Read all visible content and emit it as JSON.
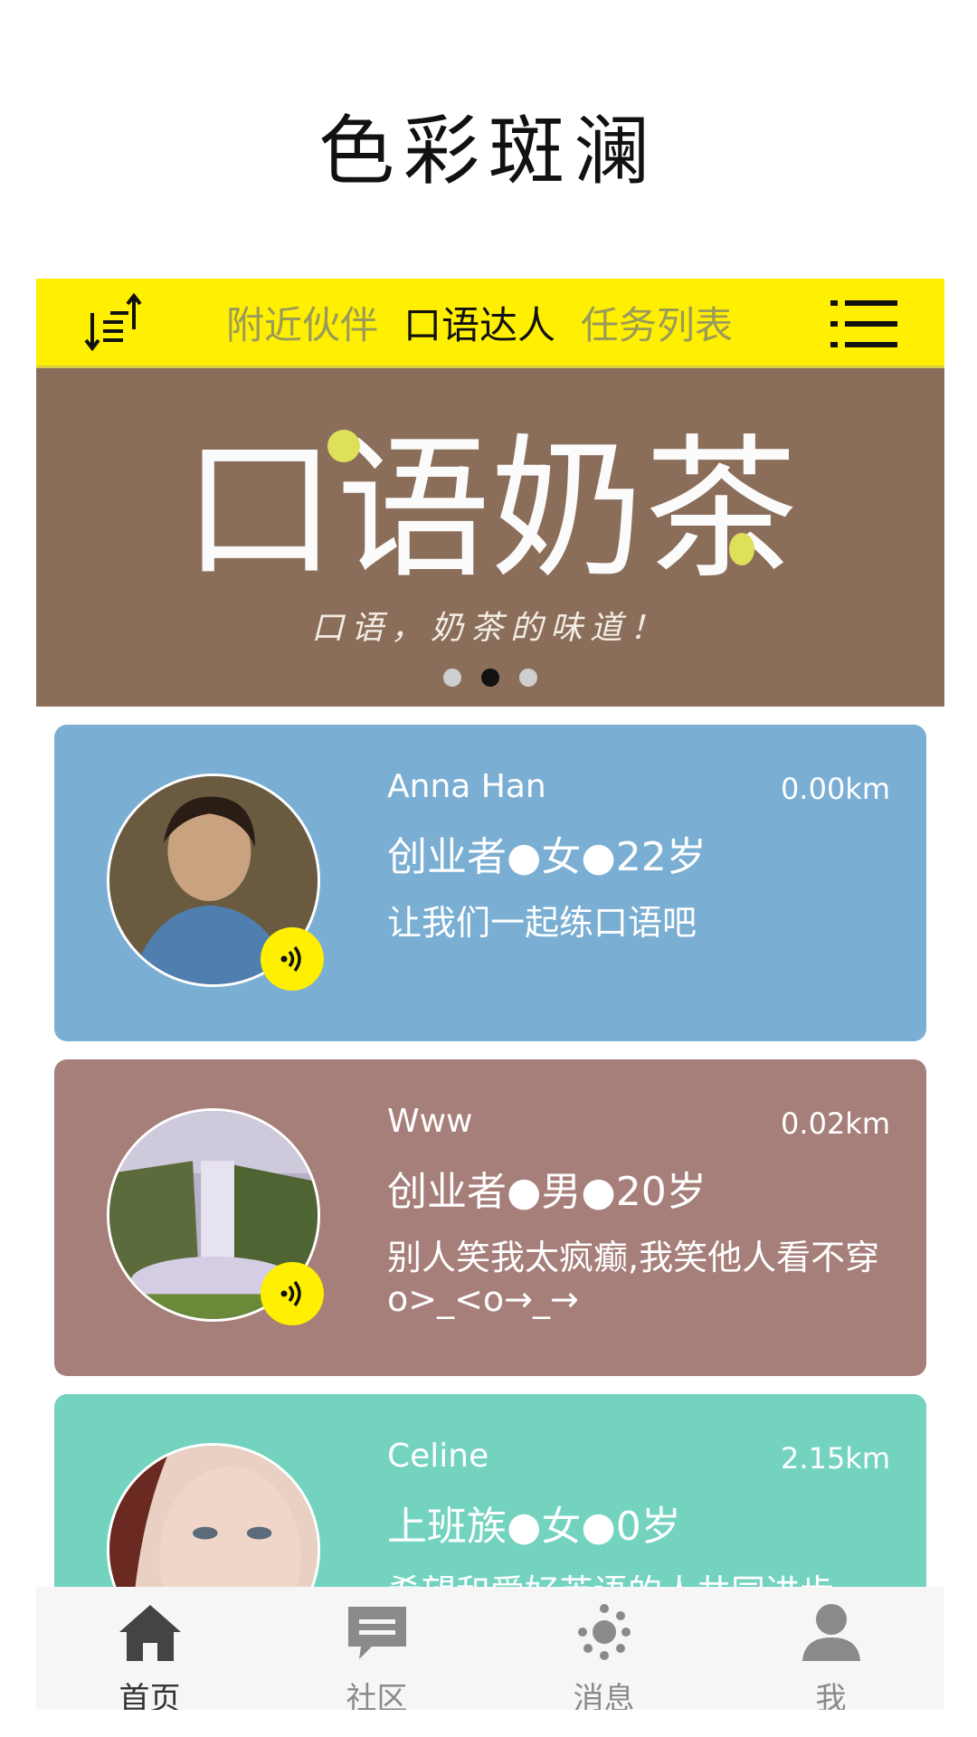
{
  "page": {
    "title": "色彩斑澜"
  },
  "topbar": {
    "tabs": [
      {
        "label": "附近伙伴",
        "active": false
      },
      {
        "label": "口语达人",
        "active": true
      },
      {
        "label": "任务列表",
        "active": false
      }
    ],
    "left_icon": "sort-icon",
    "right_icon": "menu-icon"
  },
  "banner": {
    "logo_text": "口语奶茶",
    "slogan": "口语，奶茶的味道！",
    "background": "#8b6e5a",
    "accent": "#dfe05a",
    "active_dot": 2,
    "dot_count": 3
  },
  "cards": [
    {
      "name": "Anna Han",
      "distance": "0.00km",
      "info": "创业者●女●22岁",
      "motto": "让我们一起练口语吧",
      "color": "#7aaed3"
    },
    {
      "name": "Www",
      "distance": "0.02km",
      "info": "创业者●男●20岁",
      "motto": "别人笑我太疯癫,我笑他人看不穿o>_<o→_→",
      "color": "#a77f7a"
    },
    {
      "name": "Celine",
      "distance": "2.15km",
      "info": "上班族●女●0岁",
      "motto": "希望和爱好英语的人共同进步",
      "color": "#73d3bf"
    }
  ],
  "bottom_nav": [
    {
      "label": "首页",
      "icon": "home-icon",
      "active": true
    },
    {
      "label": "社区",
      "icon": "chat-icon",
      "active": false
    },
    {
      "label": "消息",
      "icon": "message-dots-icon",
      "active": false
    },
    {
      "label": "我",
      "icon": "user-icon",
      "active": false
    }
  ],
  "colors": {
    "accent_yellow": "#ffef00",
    "text_dark": "#111111"
  }
}
